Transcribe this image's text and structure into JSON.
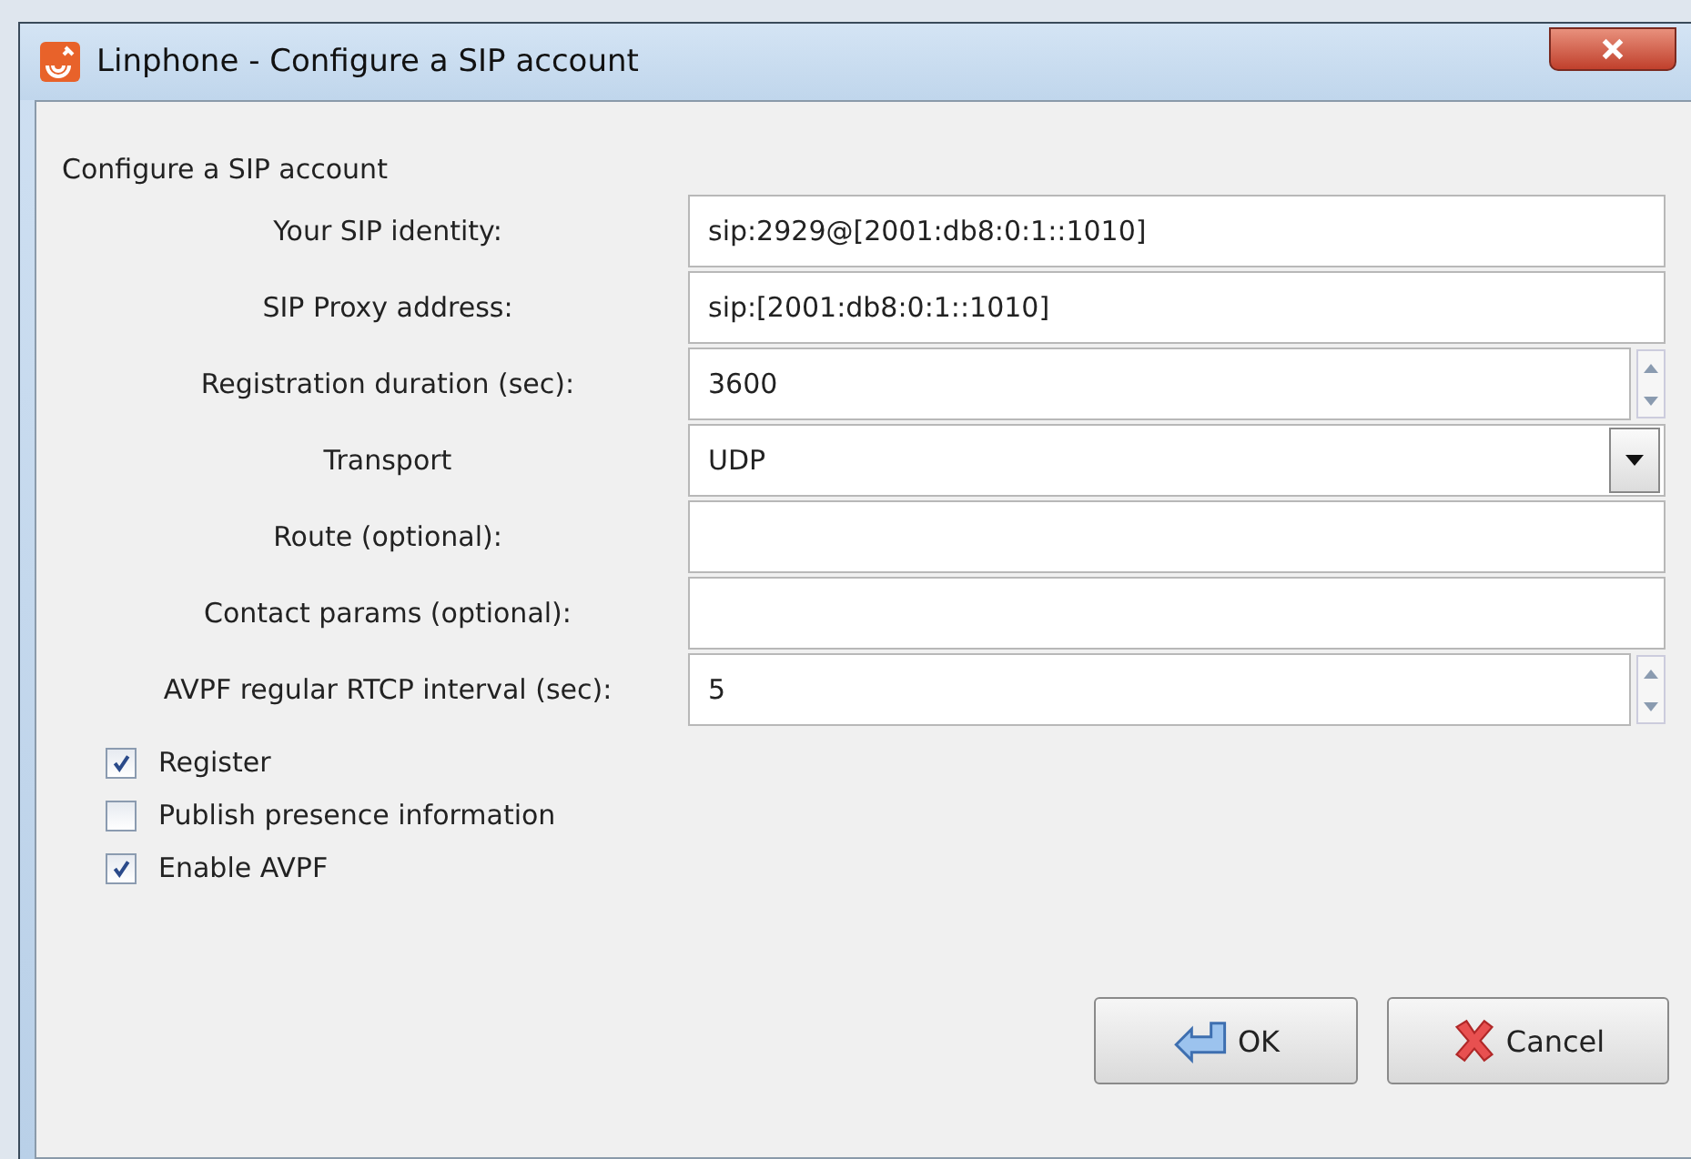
{
  "window": {
    "title": "Linphone - Configure a SIP account"
  },
  "section_title": "Configure a SIP account",
  "fields": [
    {
      "kind": "text",
      "label": "Your SIP identity:",
      "value": "sip:2929@[2001:db8:0:1::1010]"
    },
    {
      "kind": "text",
      "label": "SIP Proxy address:",
      "value": "sip:[2001:db8:0:1::1010]"
    },
    {
      "kind": "spin",
      "label": "Registration duration (sec):",
      "value": "3600"
    },
    {
      "kind": "combo",
      "label": "Transport",
      "value": "UDP"
    },
    {
      "kind": "text",
      "label": "Route (optional):"
    },
    {
      "kind": "text",
      "label": "Contact params (optional):"
    },
    {
      "kind": "spin",
      "label": "AVPF regular RTCP interval (sec):",
      "value": "5"
    }
  ],
  "checkboxes": [
    {
      "label": "Register",
      "checked": true
    },
    {
      "label": "Publish presence information",
      "checked": false
    },
    {
      "label": "Enable AVPF",
      "checked": true
    }
  ],
  "buttons": [
    {
      "kind": "ok",
      "label": "OK"
    },
    {
      "kind": "cancel",
      "label": "Cancel"
    }
  ]
}
